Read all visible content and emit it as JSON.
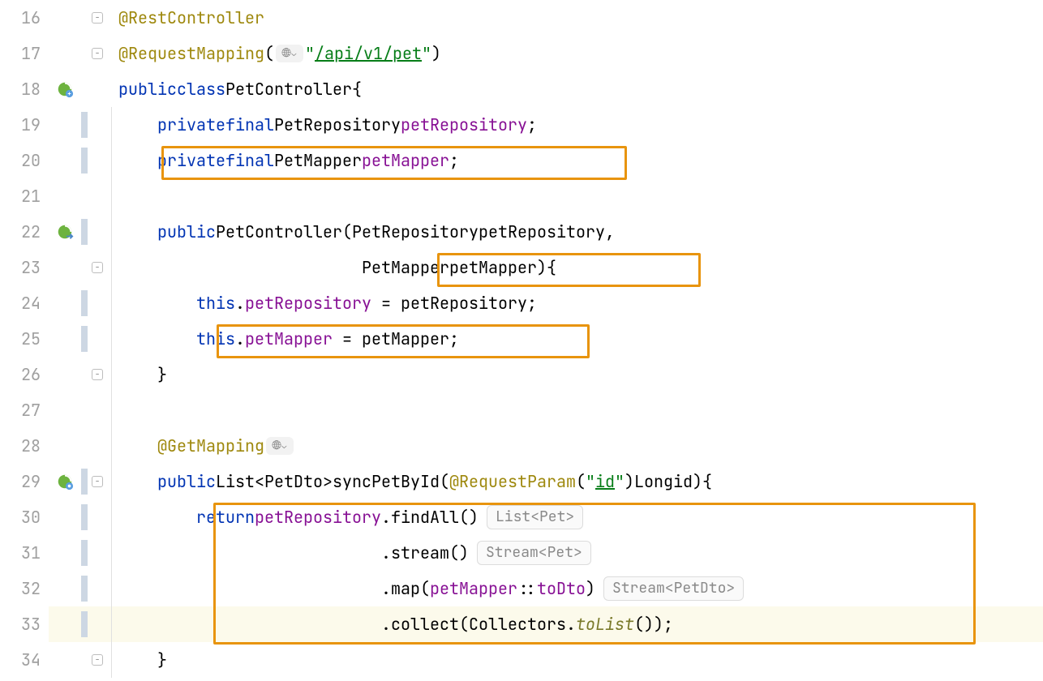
{
  "line_numbers": [
    "16",
    "17",
    "18",
    "19",
    "20",
    "21",
    "22",
    "23",
    "24",
    "25",
    "26",
    "27",
    "28",
    "29",
    "30",
    "31",
    "32",
    "33",
    "34"
  ],
  "tokens": {
    "at": "@",
    "RestController": "RestController",
    "RequestMapping": "RequestMapping",
    "lpar": "(",
    "rpar": ")",
    "lbr": "{",
    "rbr": "}",
    "semi": ";",
    "comma": ",",
    "eq": " = ",
    "dot": ".",
    "dcolon": "::",
    "lt": "<",
    "gt": ">",
    "quote": "\"",
    "public": "public",
    "class": "class",
    "private": "private",
    "final": "final",
    "return": "return",
    "this": "this",
    "PetController": "PetController",
    "PetRepository": "PetRepository",
    "petRepository": "petRepository",
    "PetMapper": "PetMapper",
    "petMapper": "petMapper",
    "GetMapping": "GetMapping",
    "List": "List",
    "PetDto": "PetDto",
    "syncPetById": "syncPetById",
    "RequestParam": "RequestParam",
    "idStr": "id",
    "Long": "Long",
    "idVar": "id",
    "findAll": "findAll",
    "stream": "stream",
    "map": "map",
    "toDto": "toDto",
    "collect": "collect",
    "Collectors": "Collectors",
    "toList": "toList",
    "api_path": "/api/v1/pet"
  },
  "indent": {
    "s0": "",
    "s1": "    ",
    "s2": "        ",
    "s3": "            ",
    "ctor_align": "                         ",
    "chain_align": "                           "
  },
  "hints": {
    "listPet": "List<Pet>",
    "streamPet": "Stream<Pet>",
    "streamPetDto": "Stream<PetDto>"
  },
  "globe": {
    "glyph": "🌐",
    "chev": "⌄"
  },
  "gutter": {
    "bean": "bean-icon",
    "bean_nav": "bean-nav-icon",
    "endpoint": "endpoint-icon"
  }
}
